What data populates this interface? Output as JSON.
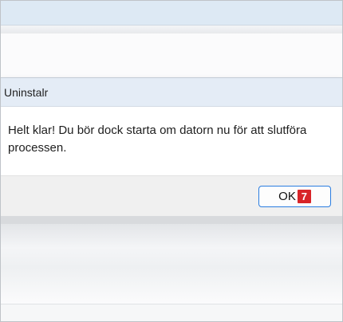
{
  "dialog": {
    "title": "Uninstalr",
    "message": "Helt klar! Du bör dock starta om datorn nu för att slutföra processen.",
    "ok_label": "OK"
  },
  "annotation": {
    "step_number": "7",
    "badge_color": "#d82428"
  },
  "colors": {
    "accent": "#2a7de1",
    "title_bar": "#e4ecf6",
    "top_band": "#dde9f4"
  }
}
